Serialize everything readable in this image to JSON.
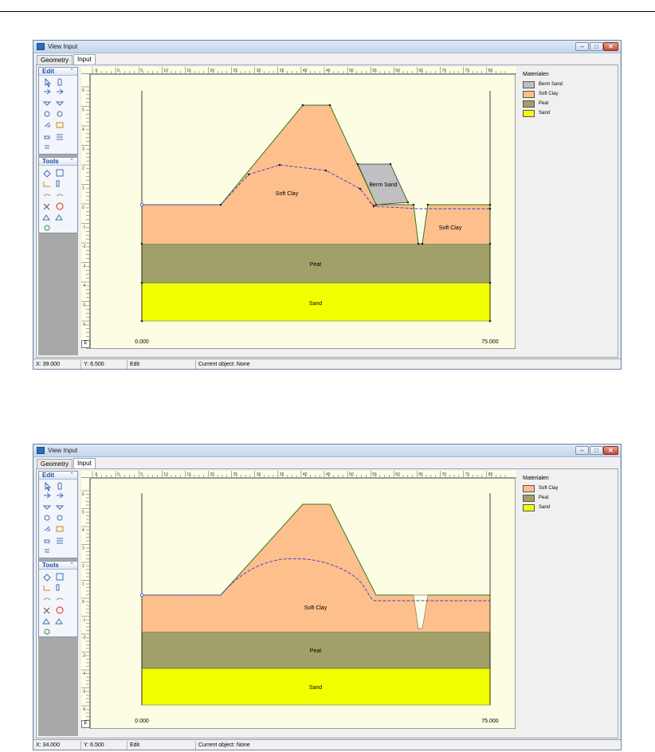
{
  "windows": [
    {
      "title": "View Input",
      "tabs": [
        "Geometry",
        "Input"
      ],
      "active_tab": "Input",
      "toolbox": {
        "edit_title": "Edit",
        "tools_title": "Tools"
      },
      "legend": {
        "title": "Materialen",
        "items": [
          {
            "name": "Berm Sand",
            "color": "#c0c0c0"
          },
          {
            "name": "Soft Clay",
            "color": "#fdbf8c"
          },
          {
            "name": "Peat",
            "color": "#a0a068"
          },
          {
            "name": "Sand",
            "color": "#f2ff00"
          }
        ]
      },
      "ruler_x": [
        "-5",
        "0",
        "5",
        "10",
        "15",
        "20",
        "25",
        "30",
        "35",
        "40",
        "45",
        "50",
        "55",
        "60",
        "65",
        "70",
        "75",
        "80"
      ],
      "ruler_y": [
        "6",
        "5",
        "4",
        "3",
        "2",
        "1",
        "0",
        "-1",
        "-2",
        "-3",
        "-4",
        "-5",
        "-6",
        "-7"
      ],
      "ruler_corner": "E",
      "labels": {
        "soft_clay": "Soft Clay",
        "soft_clay_right": "Soft Clay",
        "berm": "Berm Sand",
        "peat": "Peat",
        "sand": "Sand",
        "left_bound": "0.000",
        "right_bound": "75.000"
      },
      "status": {
        "x": "X: 39.000",
        "y": "Y: 6.500",
        "mode": "Edit",
        "current": "Current object: None"
      }
    },
    {
      "title": "View Input",
      "tabs": [
        "Geometry",
        "Input"
      ],
      "active_tab": "Input",
      "toolbox": {
        "edit_title": "Edit",
        "tools_title": "Tools"
      },
      "legend": {
        "title": "Materialen",
        "items": [
          {
            "name": "Soft Clay",
            "color": "#fdbf8c"
          },
          {
            "name": "Peat",
            "color": "#a0a068"
          },
          {
            "name": "Sand",
            "color": "#f2ff00"
          }
        ]
      },
      "ruler_x": [
        "-5",
        "0",
        "5",
        "10",
        "15",
        "20",
        "25",
        "30",
        "35",
        "40",
        "45",
        "50",
        "55",
        "60",
        "65",
        "70",
        "75",
        "80"
      ],
      "ruler_y": [
        "6",
        "5",
        "4",
        "3",
        "2",
        "1",
        "0",
        "-1",
        "-2",
        "-3",
        "-4",
        "-5",
        "-6",
        "-7"
      ],
      "ruler_corner": "E",
      "labels": {
        "soft_clay": "Soft Clay",
        "peat": "Peat",
        "sand": "Sand",
        "left_bound": "0.000",
        "right_bound": "75.000"
      },
      "status": {
        "x": "X: 34.000",
        "y": "Y: 6.500",
        "mode": "Edit",
        "current": "Current object: None"
      }
    }
  ],
  "colors": {
    "soft_clay": "#fdbf8c",
    "peat": "#a0a068",
    "sand": "#f2ff00",
    "berm": "#c0c0c0",
    "canvas": "#fdfde4",
    "outline": "#2e7d1e",
    "phreatic": "#3b3bd6"
  }
}
